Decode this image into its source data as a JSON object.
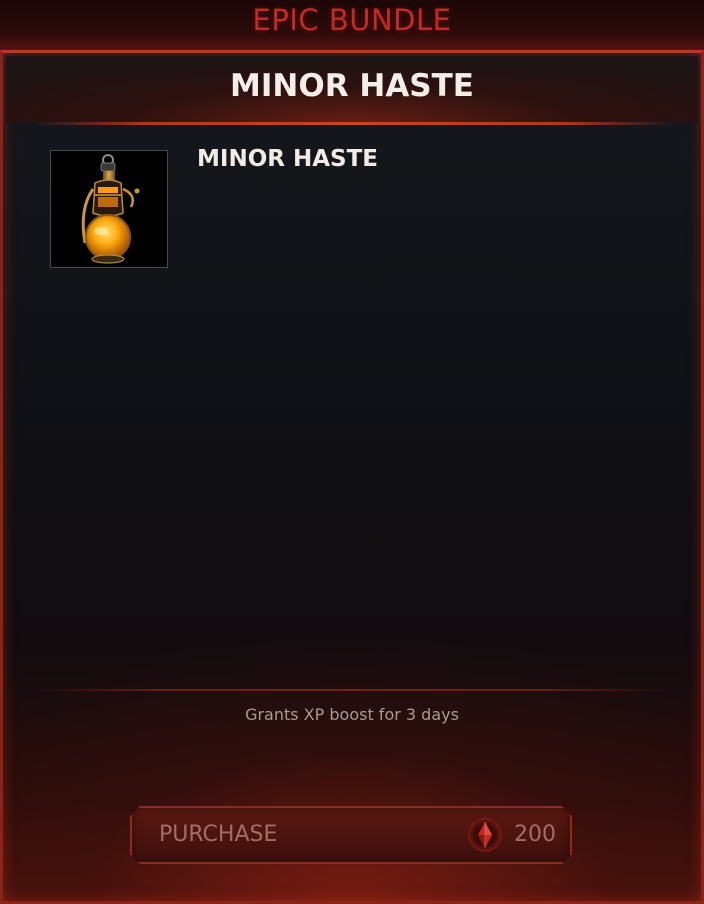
{
  "bundle": {
    "title": "EPIC BUNDLE"
  },
  "panel": {
    "title": "MINOR HASTE"
  },
  "item": {
    "name": "MINOR HASTE",
    "icon": "potion-lantern-icon",
    "description": "Grants XP boost for 3 days"
  },
  "purchase": {
    "label": "PURCHASE",
    "currency_icon": "red-gem-icon",
    "price": "200"
  },
  "colors": {
    "accent": "#c42a25",
    "panel_border": "#8a2418",
    "button_text": "#a46d64"
  }
}
